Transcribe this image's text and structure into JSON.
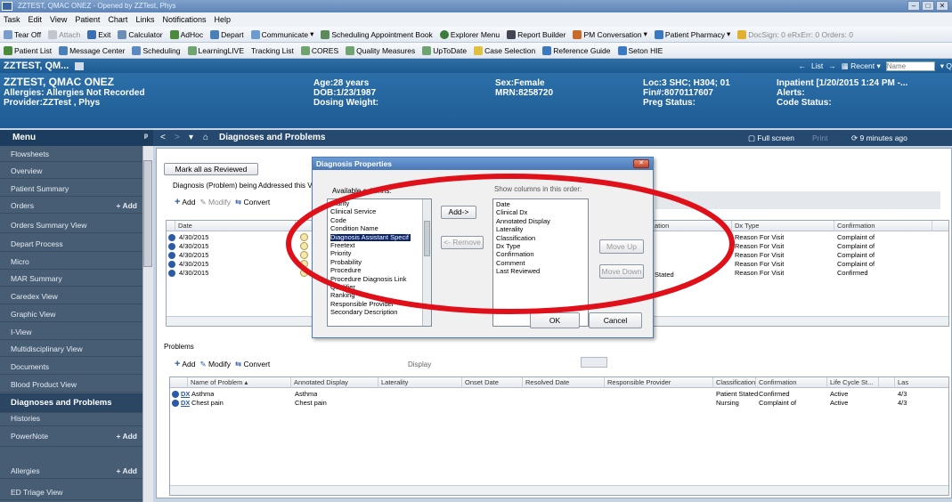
{
  "window": {
    "title": "ZZTEST, QMAC ONEZ - Opened by ZZTest, Phys"
  },
  "menubar": [
    "Task",
    "Edit",
    "View",
    "Patient",
    "Chart",
    "Links",
    "Notifications",
    "Help"
  ],
  "toolbar1": {
    "items": [
      "Tear Off",
      "Attach",
      "Exit",
      "Calculator",
      "AdHoc",
      "Depart",
      "Communicate",
      "Scheduling Appointment Book",
      "Explorer Menu",
      "Report Builder",
      "PM Conversation",
      "Patient Pharmacy"
    ],
    "counts": "DocSign: 0  eRxErr: 0  Orders: 0"
  },
  "toolbar2": {
    "items": [
      "Patient List",
      "Message Center",
      "Scheduling",
      "LearningLIVE",
      "Tracking List",
      "CORES",
      "Quality Measures",
      "UpToDate",
      "Case Selection",
      "Reference Guide",
      "Seton HIE"
    ]
  },
  "patient_bar": {
    "short_name": "ZZTEST, QM...",
    "list": "List",
    "recent": "Recent",
    "name_placeholder": "Name"
  },
  "banner": {
    "name": "ZZTEST, QMAC ONEZ",
    "allergies": "Allergies: Allergies Not Recorded",
    "provider": "Provider:ZZTest , Phys",
    "age": "Age:28 years",
    "dob": "DOB:1/23/1987",
    "dosing_weight": "Dosing Weight:",
    "sex": "Sex:Female",
    "mrn": "MRN:8258720",
    "loc": "Loc:3 SHC; H304; 01",
    "fin": "Fin#:8070117607",
    "preg": "Preg Status:",
    "inpatient": "Inpatient [1/20/2015 1:24 PM -...",
    "alerts": "Alerts:",
    "code_status": "Code Status:"
  },
  "menu": {
    "title": "Menu",
    "items": [
      {
        "label": "Flowsheets"
      },
      {
        "label": "Overview"
      },
      {
        "label": "Patient Summary"
      },
      {
        "label": "Orders",
        "add": "Add"
      },
      {
        "label": "Orders Summary View"
      },
      {
        "label": "Depart Process"
      },
      {
        "label": "Micro"
      },
      {
        "label": "MAR Summary"
      },
      {
        "label": "Caredex View"
      },
      {
        "label": "Graphic View"
      },
      {
        "label": "I-View"
      },
      {
        "label": "Multidisciplinary View"
      },
      {
        "label": "Documents"
      },
      {
        "label": "Blood Product View"
      },
      {
        "label": "Diagnoses and Problems",
        "selected": true
      },
      {
        "label": "Histories"
      },
      {
        "label": "PowerNote",
        "add": "Add"
      },
      {
        "label": "Allergies",
        "add": "Add"
      },
      {
        "label": "ED Triage View"
      }
    ]
  },
  "content": {
    "title": "Diagnoses and Problems",
    "full_screen": "Full screen",
    "print": "Print",
    "last_refresh": "9 minutes ago",
    "mark_reviewed": "Mark all as Reviewed",
    "diag_section_label": "Diagnosis (Problem) being Addressed this V",
    "add": "Add",
    "modify": "Modify",
    "convert": "Convert",
    "diag_cols": [
      "Date",
      "Dx Type",
      "Confirmation"
    ],
    "diag_partial_col": "ation",
    "diag_rows": [
      {
        "date": "4/30/2015",
        "dx_type": "Reason For Visit",
        "confirmation": "Complaint of"
      },
      {
        "date": "4/30/2015",
        "dx_type": "Reason For Visit",
        "confirmation": "Complaint of"
      },
      {
        "date": "4/30/2015",
        "dx_type": "Reason For Visit",
        "confirmation": "Complaint of"
      },
      {
        "date": "4/30/2015",
        "dx_type": "Reason For Visit",
        "confirmation": "Complaint of"
      },
      {
        "date": "4/30/2015",
        "dx_type": "Reason For Visit",
        "confirmation": "Confirmed"
      }
    ],
    "diag_row5_partial": "Stated",
    "problems_label": "Problems",
    "display_label": "Display",
    "prob_cols": [
      "Name of Problem",
      "Annotated Display",
      "Laterality",
      "Onset Date",
      "Resolved Date",
      "Responsible Provider",
      "Classification",
      "Confirmation",
      "Life Cycle St...",
      "Las"
    ],
    "prob_rows": [
      {
        "name": "Asthma",
        "annotated": "Asthma",
        "classification": "Patient Stated",
        "confirmation": "Confirmed",
        "life_cycle": "Active",
        "last": "4/3"
      },
      {
        "name": "Chest pain",
        "annotated": "Chest pain",
        "classification": "Nursing",
        "confirmation": "Complaint of",
        "life_cycle": "Active",
        "last": "4/3"
      }
    ],
    "dx_badge": "DX"
  },
  "dialog": {
    "title": "Diagnosis Properties",
    "available_label": "Available columns:",
    "show_label": "Show columns in this order:",
    "available": [
      "Clarity",
      "Clinical Service",
      "Code",
      "Condition Name",
      "Diagnosis Assistant Specif",
      "Freetext",
      "Priority",
      "Probability",
      "Procedure",
      "Procedure Diagnosis Link",
      "Qualifier",
      "Ranking",
      "Responsible Provider",
      "Secondary Description"
    ],
    "selected_index": 4,
    "shown": [
      "Date",
      "Clinical Dx",
      "Annotated Display",
      "Laterality",
      "Classification",
      "Dx Type",
      "Confirmation",
      "Comment",
      "Last Reviewed"
    ],
    "add_btn": "Add->",
    "remove_btn": "<- Remove",
    "move_up": "Move Up",
    "move_down": "Move Down",
    "ok": "OK",
    "cancel": "Cancel"
  },
  "colors": {
    "banner": "#1e5c95",
    "menu_bg": "#475d74",
    "annotation": "#e0101a",
    "selection": "#0a246a"
  }
}
